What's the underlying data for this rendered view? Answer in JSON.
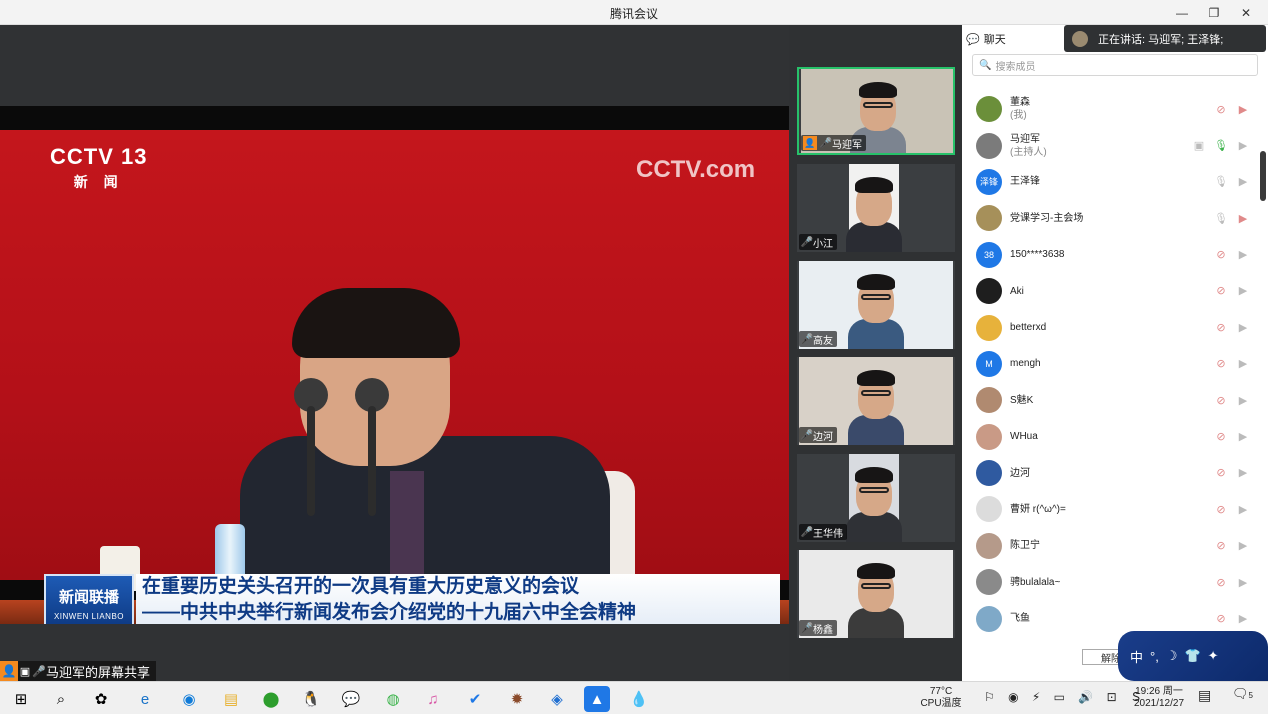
{
  "window": {
    "title": "腾讯会议"
  },
  "share": {
    "label": "马迎军的屏幕共享",
    "broadcast": {
      "channel": "CCTV 13",
      "channel_sub": "新 闻",
      "watermark": "CCTV.com",
      "show_badge": "新闻联播",
      "show_badge_en": "XINWEN LIANBO",
      "headline_1": "在重要历史关头召开的一次具有重大历史意义的会议",
      "headline_2": "——中共中央举行新闻发布会介绍党的十九届六中全会精神"
    }
  },
  "videos": [
    {
      "name": "马迎军",
      "host": true,
      "mic": "on",
      "active": true
    },
    {
      "name": "小江",
      "host": false,
      "mic": "off"
    },
    {
      "name": "高友",
      "host": false,
      "mic": "off"
    },
    {
      "name": "边河",
      "host": false,
      "mic": "off"
    },
    {
      "name": "王华伟",
      "host": false,
      "mic": "off"
    },
    {
      "name": "杨鑫",
      "host": false,
      "mic": "off"
    }
  ],
  "panel": {
    "tab": "聊天",
    "speaking": "正在讲话: 马迎军; 王泽锋;",
    "search_placeholder": "搜索成员",
    "unmute_label": "解除",
    "ime_text": "中"
  },
  "members": [
    {
      "name": "董森",
      "role": "(我)",
      "avatar": "",
      "color": "#6b8f3a",
      "mic": "muted",
      "video": "off-red"
    },
    {
      "name": "马迎军",
      "role": "(主持人)",
      "avatar": "",
      "color": "#7b7b7b",
      "mic": "on",
      "video": "off",
      "screen": true
    },
    {
      "name": "王泽锋",
      "role": "",
      "avatar": "泽锋",
      "color": "#1f78e6",
      "mic": "idle",
      "video": "off"
    },
    {
      "name": "党课学习-主会场",
      "role": "",
      "avatar": "",
      "color": "#a6905a",
      "mic": "idle",
      "video": "off-red"
    },
    {
      "name": "150****3638",
      "role": "",
      "avatar": "38",
      "color": "#1f78e6",
      "mic": "muted",
      "video": "off"
    },
    {
      "name": "Aki",
      "role": "",
      "avatar": "",
      "color": "#1e1e1e",
      "mic": "muted",
      "video": "off"
    },
    {
      "name": "betterxd",
      "role": "",
      "avatar": "",
      "color": "#e7b23b",
      "mic": "muted",
      "video": "off"
    },
    {
      "name": "mengh",
      "role": "",
      "avatar": "M",
      "color": "#1f78e6",
      "mic": "muted",
      "video": "off"
    },
    {
      "name": "S魅K",
      "role": "",
      "avatar": "",
      "color": "#b08a70",
      "mic": "muted",
      "video": "off"
    },
    {
      "name": "WHua",
      "role": "",
      "avatar": "",
      "color": "#c99a86",
      "mic": "muted",
      "video": "off"
    },
    {
      "name": "边河",
      "role": "",
      "avatar": "",
      "color": "#2f5aa0",
      "mic": "muted",
      "video": "off"
    },
    {
      "name": "曹妍 r(^ω^)=",
      "role": "",
      "avatar": "",
      "color": "#dcdcdc",
      "mic": "muted",
      "video": "off"
    },
    {
      "name": "陈卫宁",
      "role": "",
      "avatar": "",
      "color": "#b59a8a",
      "mic": "muted",
      "video": "off"
    },
    {
      "name": "骋bulalala~",
      "role": "",
      "avatar": "",
      "color": "#8a8a8a",
      "mic": "muted",
      "video": "off"
    },
    {
      "name": "飞鱼",
      "role": "",
      "avatar": "",
      "color": "#7fa9c8",
      "mic": "muted",
      "video": "off"
    }
  ],
  "taskbar": {
    "temp": "77°C",
    "temp_label": "CPU温度",
    "time": "19:26 周一",
    "date": "2021/12/27",
    "notif_count": "5"
  },
  "colors": {
    "accent": "#1f78e6",
    "active_border": "#27c26a",
    "muted": "#e08a8a",
    "share_bg": "#303234"
  }
}
